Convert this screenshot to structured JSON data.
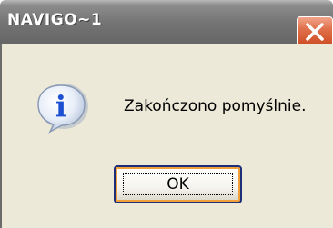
{
  "window": {
    "title": "NAVIGO~1",
    "close_icon": "close-icon"
  },
  "dialog": {
    "icon": "information-icon",
    "icon_glyph": "i",
    "message": "Zakończono pomyślnie.",
    "ok_label": "OK"
  },
  "colors": {
    "titlebar": "#737373",
    "close_button": "#e0704b",
    "dialog_background": "#ece9d8",
    "button_border": "#1c2f78",
    "button_focus_ring": "#f2a03a",
    "info_icon_blue": "#1d4fd3"
  }
}
